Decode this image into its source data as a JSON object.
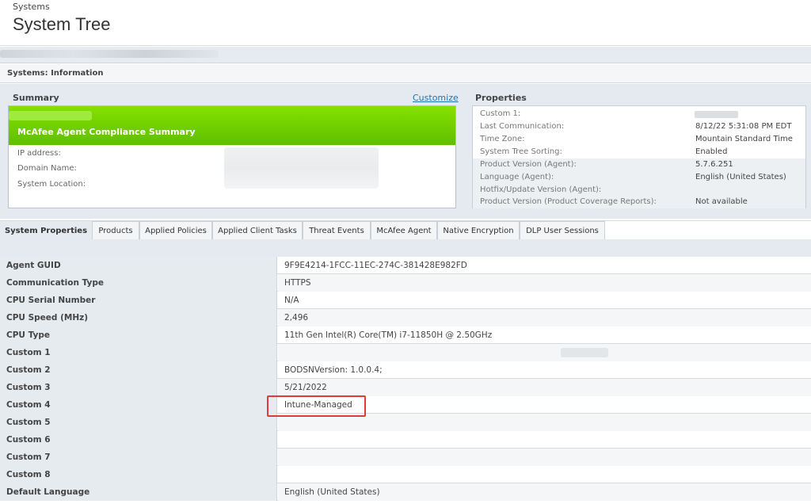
{
  "header": {
    "breadcrumb": "Systems",
    "title": "System Tree"
  },
  "section": {
    "title": "Systems: Information"
  },
  "summary": {
    "heading": "Summary",
    "customize_link": "Customize",
    "compliance_title": "McAfee Agent Compliance Summary",
    "fields": [
      "IP address:",
      "Domain Name:",
      "System Location:"
    ]
  },
  "properties": {
    "heading": "Properties",
    "rows": [
      {
        "label": "Custom 1:",
        "value": ""
      },
      {
        "label": "Last Communication:",
        "value": "8/12/22 5:31:08 PM EDT"
      },
      {
        "label": "Time Zone:",
        "value": "Mountain Standard Time"
      },
      {
        "label": "System Tree Sorting:",
        "value": "Enabled"
      },
      {
        "label": "Product Version (Agent):",
        "value": "5.7.6.251"
      },
      {
        "label": "Language (Agent):",
        "value": "English (United States)"
      },
      {
        "label": "Hotfix/Update Version (Agent):",
        "value": ""
      },
      {
        "label": "Product Version (Product Coverage Reports):",
        "value": "Not available"
      }
    ]
  },
  "tabs": [
    "System Properties",
    "Products",
    "Applied Policies",
    "Applied Client Tasks",
    "Threat Events",
    "McAfee Agent",
    "Native Encryption",
    "DLP User Sessions"
  ],
  "system_properties": [
    {
      "label": "Agent GUID",
      "value": "9F9E4214-1FCC-11EC-274C-381428E982FD"
    },
    {
      "label": "Communication Type",
      "value": "HTTPS"
    },
    {
      "label": "CPU Serial Number",
      "value": "N/A"
    },
    {
      "label": "CPU Speed (MHz)",
      "value": "2,496"
    },
    {
      "label": "CPU Type",
      "value": "11th Gen Intel(R) Core(TM) i7-11850H @ 2.50GHz"
    },
    {
      "label": "Custom 1",
      "value": ""
    },
    {
      "label": "Custom 2",
      "value": "BODSNVersion: 1.0.0.4;"
    },
    {
      "label": "Custom 3",
      "value": "5/21/2022"
    },
    {
      "label": "Custom 4",
      "value": "Intune-Managed"
    },
    {
      "label": "Custom 5",
      "value": ""
    },
    {
      "label": "Custom 6",
      "value": ""
    },
    {
      "label": "Custom 7",
      "value": ""
    },
    {
      "label": "Custom 8",
      "value": ""
    },
    {
      "label": "Default Language",
      "value": "English (United States)"
    }
  ],
  "colors": {
    "compliance_green": "#6fd000",
    "link_blue": "#1a73b8",
    "highlight_red": "#e03a3a"
  }
}
